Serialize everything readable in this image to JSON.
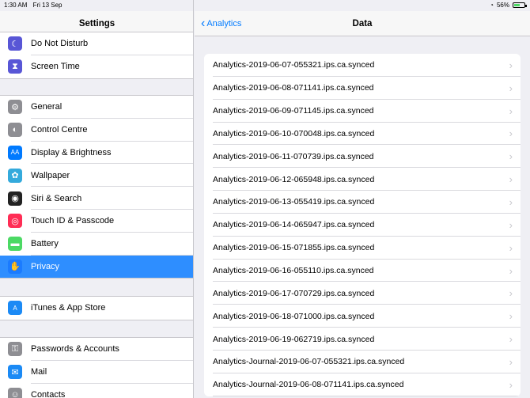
{
  "status": {
    "time": "1:30 AM",
    "date": "Fri 13 Sep",
    "battery": "56%",
    "battery_level": 0.56
  },
  "sidebar": {
    "title": "Settings",
    "group1": [
      {
        "label": "Do Not Disturb",
        "icon": "moon-icon",
        "color": "#5856d6"
      },
      {
        "label": "Screen Time",
        "icon": "hourglass-icon",
        "color": "#5856d6"
      }
    ],
    "group2": [
      {
        "label": "General",
        "icon": "gear-icon",
        "color": "#8e8e93"
      },
      {
        "label": "Control Centre",
        "icon": "toggles-icon",
        "color": "#8e8e93"
      },
      {
        "label": "Display & Brightness",
        "icon": "text-size-icon",
        "color": "#007aff"
      },
      {
        "label": "Wallpaper",
        "icon": "flower-icon",
        "color": "#34aadc"
      },
      {
        "label": "Siri & Search",
        "icon": "siri-icon",
        "color": "#222222"
      },
      {
        "label": "Touch ID & Passcode",
        "icon": "fingerprint-icon",
        "color": "#ff2d55"
      },
      {
        "label": "Battery",
        "icon": "battery-icon",
        "color": "#4cd964"
      },
      {
        "label": "Privacy",
        "icon": "hand-icon",
        "color": "#007aff",
        "selected": true
      }
    ],
    "group3": [
      {
        "label": "iTunes & App Store",
        "icon": "app-store-icon",
        "color": "#1b8af5"
      }
    ],
    "group4": [
      {
        "label": "Passwords & Accounts",
        "icon": "key-icon",
        "color": "#8e8e93"
      },
      {
        "label": "Mail",
        "icon": "mail-icon",
        "color": "#1b8af5"
      },
      {
        "label": "Contacts",
        "icon": "contacts-icon",
        "color": "#8e8e93"
      }
    ]
  },
  "main": {
    "back_label": "Analytics",
    "title": "Data",
    "items": [
      "Analytics-2019-06-07-055321.ips.ca.synced",
      "Analytics-2019-06-08-071141.ips.ca.synced",
      "Analytics-2019-06-09-071145.ips.ca.synced",
      "Analytics-2019-06-10-070048.ips.ca.synced",
      "Analytics-2019-06-11-070739.ips.ca.synced",
      "Analytics-2019-06-12-065948.ips.ca.synced",
      "Analytics-2019-06-13-055419.ips.ca.synced",
      "Analytics-2019-06-14-065947.ips.ca.synced",
      "Analytics-2019-06-15-071855.ips.ca.synced",
      "Analytics-2019-06-16-055110.ips.ca.synced",
      "Analytics-2019-06-17-070729.ips.ca.synced",
      "Analytics-2019-06-18-071000.ips.ca.synced",
      "Analytics-2019-06-19-062719.ips.ca.synced",
      "Analytics-Journal-2019-06-07-055321.ips.ca.synced",
      "Analytics-Journal-2019-06-08-071141.ips.ca.synced"
    ]
  }
}
